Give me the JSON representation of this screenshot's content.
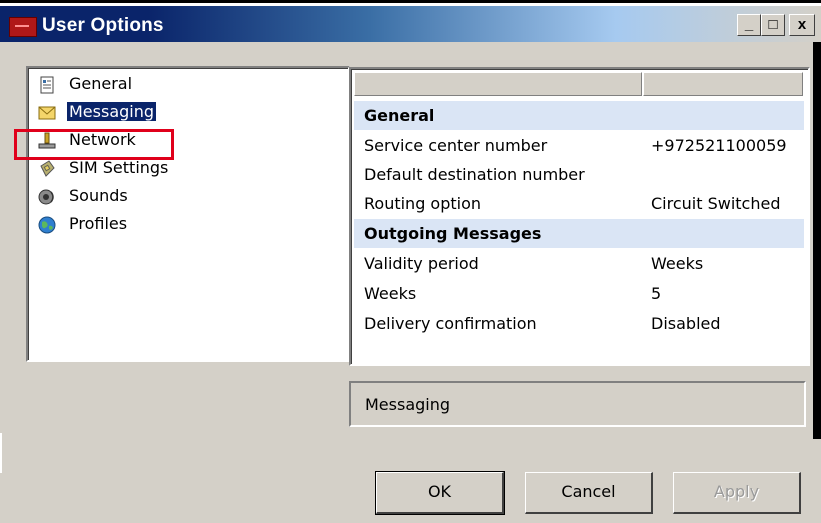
{
  "window": {
    "title": "User Options",
    "controls": [
      "_",
      "□",
      "x"
    ]
  },
  "nav": {
    "items": [
      {
        "label": "General",
        "icon": "document-icon",
        "selected": false
      },
      {
        "label": "Messaging",
        "icon": "envelope-icon",
        "selected": true
      },
      {
        "label": "Network",
        "icon": "network-icon",
        "selected": false,
        "highlighted": true
      },
      {
        "label": "SIM Settings",
        "icon": "sim-card-icon",
        "selected": false
      },
      {
        "label": "Sounds",
        "icon": "speaker-icon",
        "selected": false
      },
      {
        "label": "Profiles",
        "icon": "globe-person-icon",
        "selected": false
      }
    ]
  },
  "properties": {
    "columns": [
      "",
      ""
    ],
    "sections": [
      {
        "title": "General",
        "rows": [
          {
            "name": "Service center number",
            "value": "+972521100059"
          },
          {
            "name": "Default destination number",
            "value": ""
          },
          {
            "name": "Routing option",
            "value": "Circuit Switched"
          }
        ]
      },
      {
        "title": "Outgoing Messages",
        "rows": [
          {
            "name": "Validity period",
            "value": "Weeks"
          },
          {
            "name": "Weeks",
            "value": "5"
          },
          {
            "name": "Delivery confirmation",
            "value": "Disabled"
          }
        ]
      }
    ]
  },
  "status": {
    "text": "Messaging"
  },
  "buttons": {
    "ok": "OK",
    "cancel": "Cancel",
    "apply": "Apply",
    "apply_enabled": false
  },
  "colors": {
    "selection": "#0a246a",
    "section_band": "#dae5f5",
    "highlight_box": "#e0001b",
    "dialog_face": "#d4d0c8"
  }
}
